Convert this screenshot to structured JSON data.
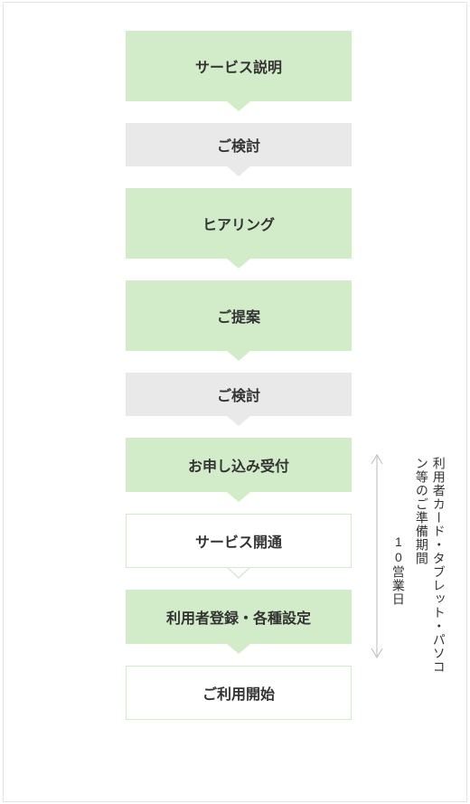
{
  "flow": {
    "steps": [
      {
        "label": "サービス説明",
        "style": "green",
        "size": "large"
      },
      {
        "label": "ご検討",
        "style": "gray",
        "size": "small"
      },
      {
        "label": "ヒアリング",
        "style": "green",
        "size": "large"
      },
      {
        "label": "ご提案",
        "style": "green",
        "size": "large"
      },
      {
        "label": "ご検討",
        "style": "gray",
        "size": "small"
      },
      {
        "label": "お申し込み受付",
        "style": "green",
        "size": "mid"
      },
      {
        "label": "サービス開通",
        "style": "white",
        "size": "mid"
      },
      {
        "label": "利用者登録・各種設定",
        "style": "green",
        "size": "mid"
      },
      {
        "label": "ご利用開始",
        "style": "white",
        "size": "mid"
      }
    ]
  },
  "annotation": {
    "days": "10営業日",
    "note": "利用者カード・タブレット・パソコン等のご準備期間"
  },
  "colors": {
    "green": "#d2ecc9",
    "gray": "#e9e9e9",
    "border": "#e3e3e3"
  }
}
